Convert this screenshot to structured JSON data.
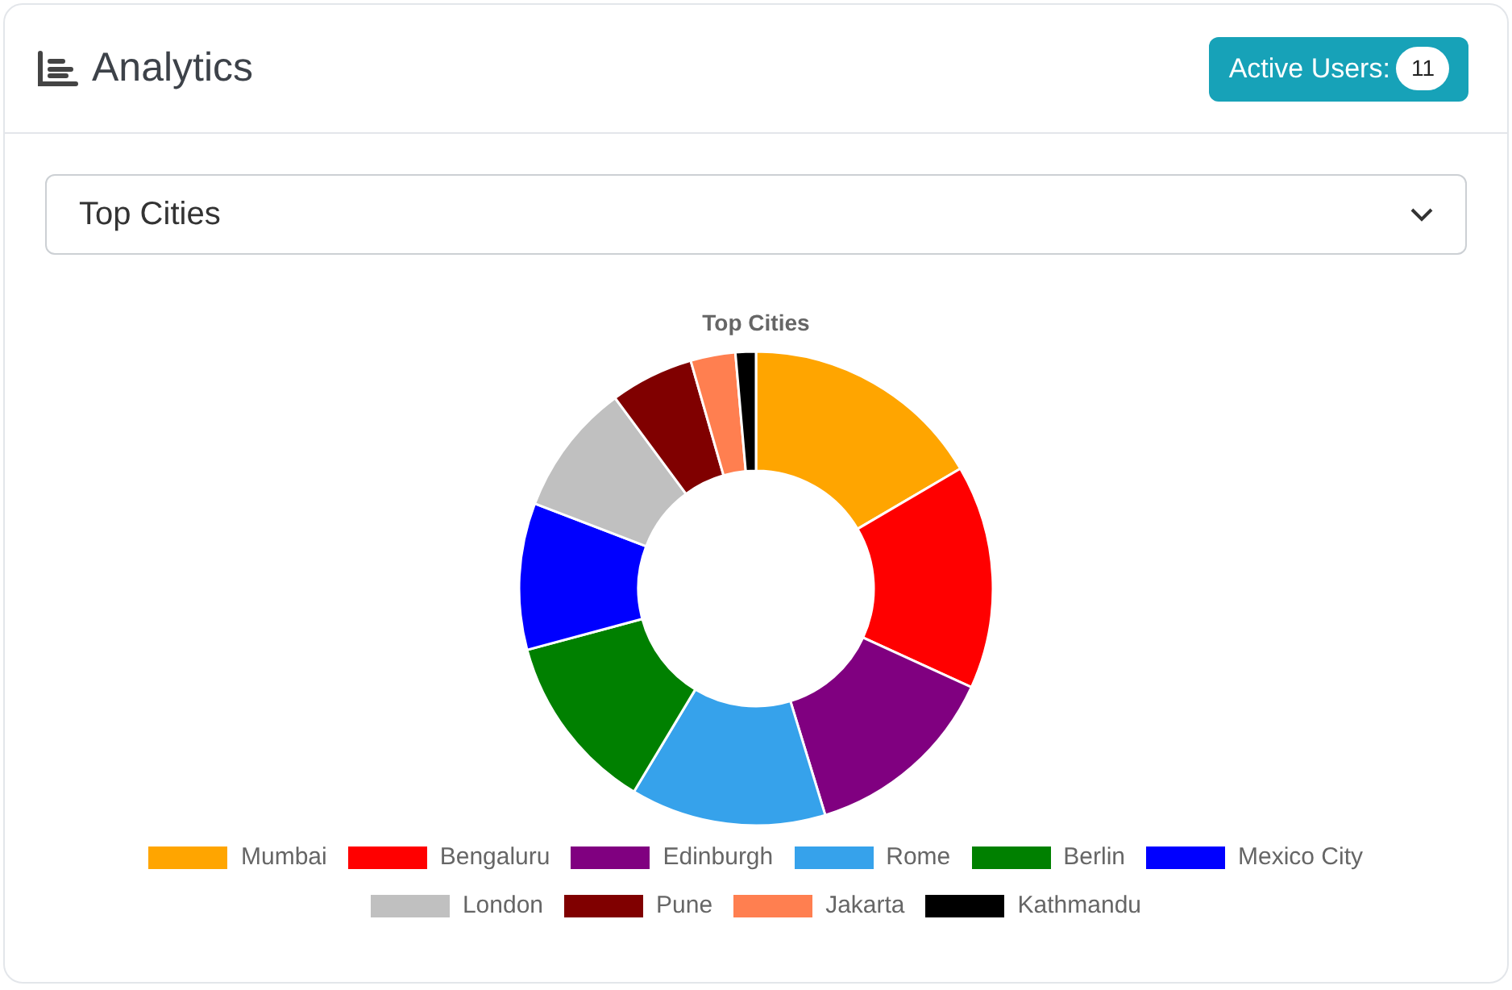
{
  "header": {
    "title": "Analytics",
    "badge": {
      "label": "Active Users:",
      "count": "11"
    }
  },
  "select": {
    "value": "Top Cities"
  },
  "chart": {
    "title": "Top Cities",
    "legend": [
      {
        "name": "Mumbai",
        "color": "#ffa500"
      },
      {
        "name": "Bengaluru",
        "color": "#ff0000"
      },
      {
        "name": "Edinburgh",
        "color": "#800080"
      },
      {
        "name": "Rome",
        "color": "#36a2eb"
      },
      {
        "name": "Berlin",
        "color": "#008000"
      },
      {
        "name": "Mexico City",
        "color": "#0000ff"
      },
      {
        "name": "London",
        "color": "#c0c0c0"
      },
      {
        "name": "Pune",
        "color": "#800000"
      },
      {
        "name": "Jakarta",
        "color": "#ff7f50"
      },
      {
        "name": "Kathmandu",
        "color": "#000000"
      }
    ]
  }
}
